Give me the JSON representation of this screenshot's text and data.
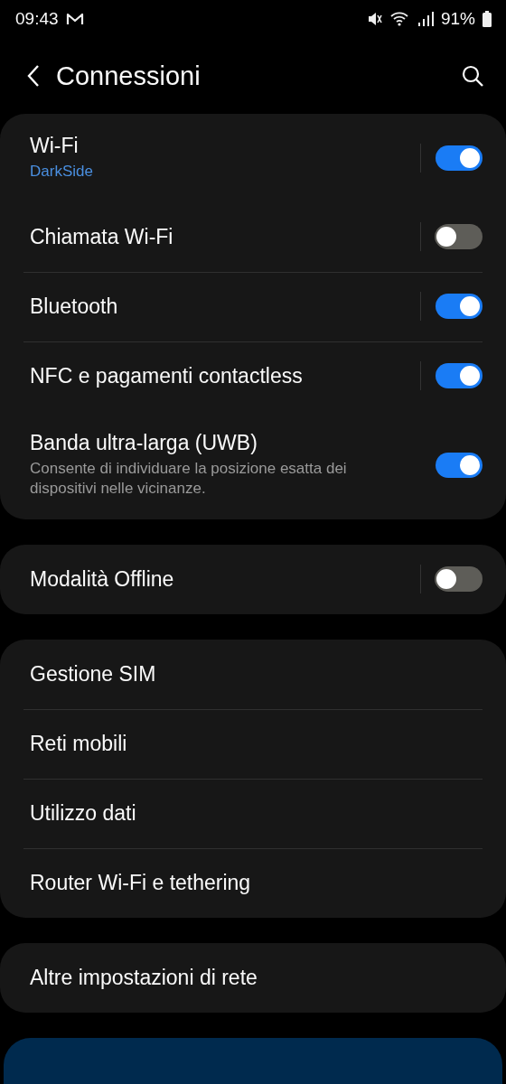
{
  "status_bar": {
    "time": "09:43",
    "battery": "91%"
  },
  "header": {
    "title": "Connessioni"
  },
  "groups": [
    {
      "items": [
        {
          "kind": "split-toggle",
          "label": "Wi-Fi",
          "status": "DarkSide",
          "on": true
        },
        {
          "kind": "split-toggle",
          "label": "Chiamata Wi-Fi",
          "on": false
        },
        {
          "kind": "split-toggle",
          "label": "Bluetooth",
          "on": true
        },
        {
          "kind": "split-toggle",
          "label": "NFC e pagamenti contactless",
          "on": true
        },
        {
          "kind": "toggle",
          "label": "Banda ultra-larga (UWB)",
          "description": "Consente di individuare la posizione esatta dei dispositivi nelle vicinanze.",
          "on": true
        }
      ]
    },
    {
      "items": [
        {
          "kind": "split-toggle",
          "label": "Modalità Offline",
          "on": false
        }
      ]
    },
    {
      "items": [
        {
          "kind": "link",
          "label": "Gestione SIM"
        },
        {
          "kind": "link",
          "label": "Reti mobili"
        },
        {
          "kind": "link",
          "label": "Utilizzo dati"
        },
        {
          "kind": "link",
          "label": "Router Wi-Fi e tethering"
        }
      ]
    },
    {
      "items": [
        {
          "kind": "link",
          "label": "Altre impostazioni di rete"
        }
      ]
    }
  ]
}
